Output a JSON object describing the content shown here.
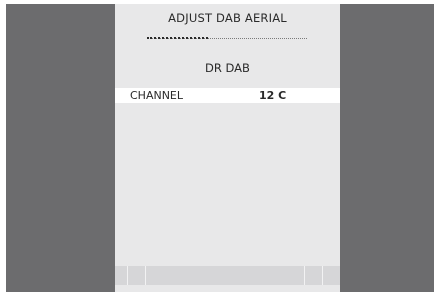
{
  "menu": {
    "title": "ADJUST DAB AERIAL",
    "station": "DR DAB",
    "signal_strength_fraction": 0.38,
    "channel": {
      "label": "CHANNEL",
      "value": "12 C"
    }
  },
  "colors": {
    "outer_background": "#6c6c6e",
    "panel_background": "#e8e8e9",
    "highlight_row": "#ffffff",
    "text": "#2a2a2a",
    "bottom_bar": "#d6d6d8"
  }
}
